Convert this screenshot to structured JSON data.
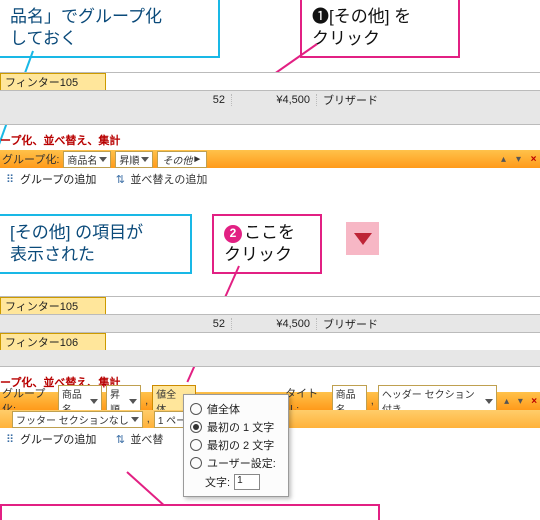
{
  "callouts": {
    "topBlue": "品名」でグループ化\nしておく",
    "topPink1": "❶[その他] を",
    "topPink2": "クリック",
    "midBlue1": "[その他] の項目が",
    "midBlue2": "表示された",
    "midPinkN": "2",
    "midPink1": "ここを",
    "midPink2": "クリック"
  },
  "rows": {
    "r1": {
      "a": "フィンター105"
    },
    "r2": {
      "a": "",
      "q": "52",
      "p": "¥4,500",
      "s": "ブリザード"
    },
    "r3": {
      "a": "フィンター105"
    },
    "r4": {
      "a": "",
      "q": "52",
      "p": "¥4,500",
      "s": "ブリザード"
    },
    "r5": {
      "a": "フィンター106"
    }
  },
  "redHeader": "ープ化、並べ替え、集計",
  "bar1": {
    "groupLabel": "グループ化:",
    "groupField": "商品名",
    "sortField": "昇順",
    "moreField": "その他",
    "addGroup": "グループの追加",
    "addSort": "並べ替えの追加"
  },
  "bar2": {
    "groupLabel": "グループ化:",
    "groupField": "商品名",
    "sortField": "昇順",
    "totalField": "値全体",
    "titleLabel": "タイトル:",
    "titleField": "商品名",
    "headerOpt": "ヘッダー セクション付き",
    "footerOpt": "フッター セクションなし",
    "pageOpt": "1 ページにグル…",
    "addGroup": "グループの追加",
    "addSort": "並べ替"
  },
  "popup": {
    "opt1": "値全体",
    "opt2": "最初の 1 文字",
    "opt3": "最初の 2 文字",
    "opt4": "ユーザー設定:",
    "charsLabel": "文字:",
    "charsVal": "1"
  }
}
